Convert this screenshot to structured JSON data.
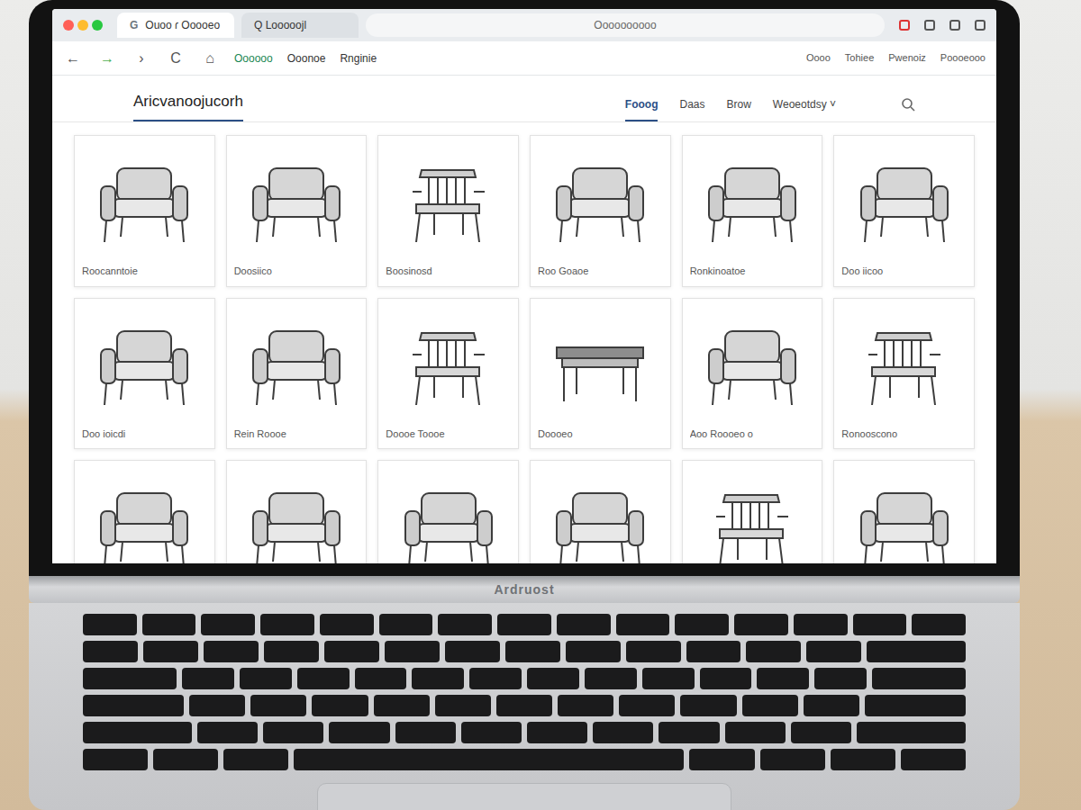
{
  "browser": {
    "tab": {
      "icon": "G",
      "label": "Ouoo ɾ  Ooooeo",
      "selected": true
    },
    "address_tab": {
      "label": "Q Looooojl",
      "selected": false
    },
    "address": "Oooooooooo",
    "nav": [
      "←",
      "→",
      "›",
      "C",
      "⌂"
    ],
    "bookmarks": [
      "Oooooo",
      "Ooonoe",
      "Rnginie"
    ],
    "links": [
      "Oooo",
      "Tohiee",
      "Pwenoiz",
      "Poooeooo"
    ]
  },
  "site": {
    "logo": "Aricvanoojucorh",
    "menu": [
      {
        "label": "Fooog",
        "selected": true
      },
      {
        "label": "Daas",
        "selected": false
      },
      {
        "label": "Brow",
        "selected": false
      },
      {
        "label": "Weoeotdsy ˅",
        "selected": false
      }
    ]
  },
  "products": [
    {
      "name": "Roocanntoie",
      "kind": "armchair"
    },
    {
      "name": "Doosiico",
      "kind": "armchair"
    },
    {
      "name": "Boosinosd",
      "kind": "spindle"
    },
    {
      "name": "Roo Goaoe",
      "kind": "armchair"
    },
    {
      "name": "Ronkinoatoe",
      "kind": "armchair"
    },
    {
      "name": "Doo iicoo",
      "kind": "armchair"
    },
    {
      "name": "Doo ioicdi",
      "kind": "armchair"
    },
    {
      "name": "Rein Roooe",
      "kind": "armchair"
    },
    {
      "name": "Doooe Toooe",
      "kind": "spindle"
    },
    {
      "name": "Doooeo",
      "kind": "table"
    },
    {
      "name": "Aoo Roooeo o",
      "kind": "armchair"
    },
    {
      "name": "Ronooscono",
      "kind": "spindle"
    },
    {
      "kind": "armchair"
    },
    {
      "kind": "armchair"
    },
    {
      "kind": "armchair"
    },
    {
      "kind": "armchair"
    },
    {
      "kind": "spindle"
    },
    {
      "kind": "armchair"
    }
  ],
  "laptop": {
    "brand": "Ardruost"
  }
}
